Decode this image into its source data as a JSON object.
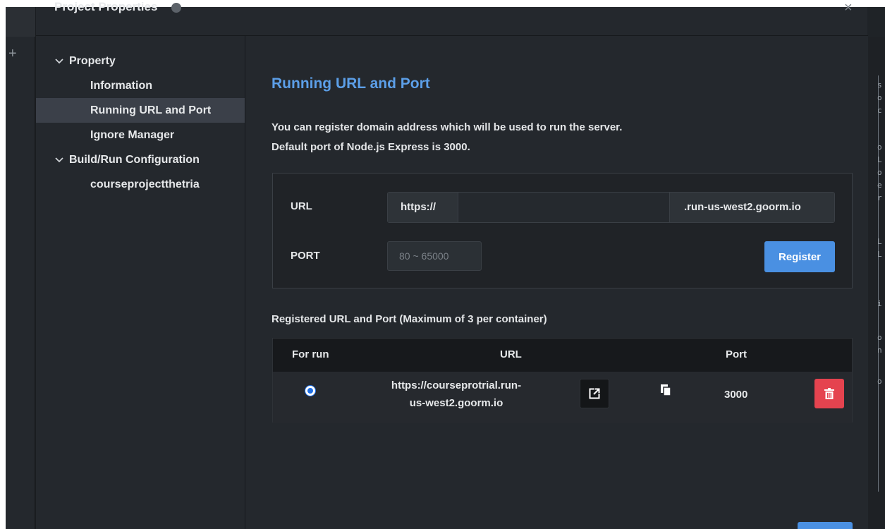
{
  "dialog": {
    "title": "Project Properties",
    "close_glyph": "×"
  },
  "background": {
    "plus_glyph": "+",
    "code_fragments": [
      "s",
      "o",
      "c",
      "",
      "o",
      "L",
      "o",
      "e",
      "r",
      "",
      "L",
      "L",
      "",
      "i",
      "",
      "o",
      "n",
      "",
      "o"
    ]
  },
  "sidebar": {
    "items": [
      {
        "label": "Property",
        "level": 1,
        "expanded": true
      },
      {
        "label": "Information",
        "level": 2
      },
      {
        "label": "Running URL and Port",
        "level": 2,
        "selected": true
      },
      {
        "label": "Ignore Manager",
        "level": 2
      },
      {
        "label": "Build/Run Configuration",
        "level": 1,
        "expanded": true
      },
      {
        "label": "courseprojectthetria",
        "level": 2
      }
    ]
  },
  "main": {
    "title": "Running URL and Port",
    "description_line1": "You can register domain address which will be used to run the server.",
    "description_line2": "Default port of Node.js Express is 3000.",
    "form": {
      "url_label": "URL",
      "url_prefix": "https://",
      "url_value": "",
      "url_suffix": ".run-us-west2.goorm.io",
      "port_label": "PORT",
      "port_placeholder": "80 ~ 65000",
      "register_label": "Register"
    },
    "registered_title": "Registered URL and Port (Maximum of 3 per container)",
    "table": {
      "headers": {
        "for_run": "For run",
        "url": "URL",
        "port": "Port"
      },
      "rows": [
        {
          "selected": true,
          "url_line1": "https://courseprotrial.run-",
          "url_line2": "us-west2.goorm.io",
          "port": "3000"
        }
      ]
    }
  },
  "colors": {
    "accent": "#4a90e2",
    "title_blue": "#5c9fe8",
    "danger": "#e5434f",
    "panel": "#24282d"
  }
}
